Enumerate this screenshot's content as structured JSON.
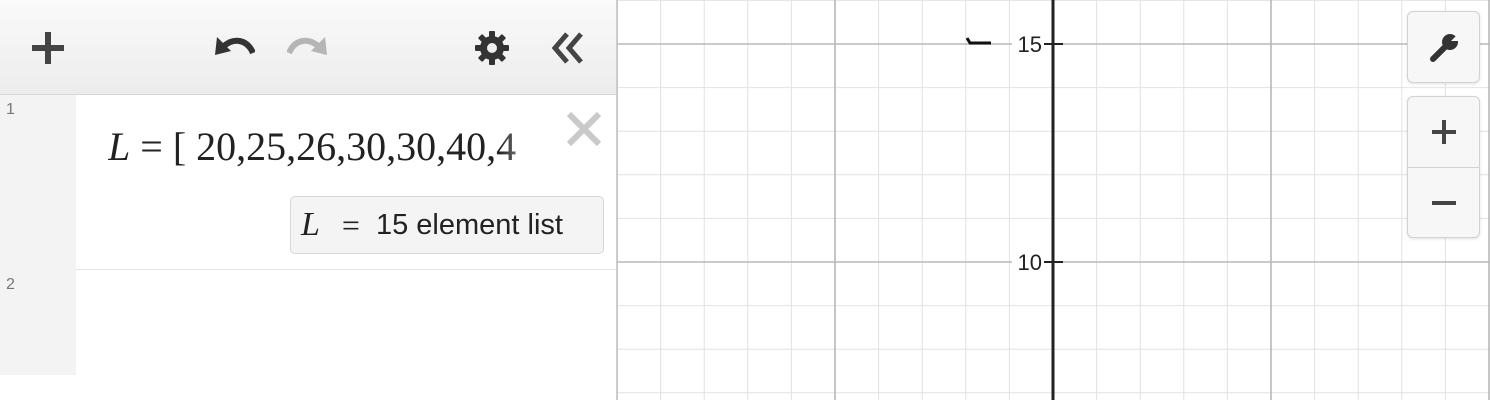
{
  "toolbar": {
    "add_icon": "plus-icon",
    "undo_icon": "undo-icon",
    "redo_icon": "redo-icon",
    "settings_icon": "gear-icon",
    "collapse_icon": "double-chevron-left-icon"
  },
  "expressions": [
    {
      "row_number": "1",
      "variable": "L",
      "equals": "=",
      "bracket": "[",
      "values_text": "20,25,26,30,30,40,4",
      "result_variable": "L",
      "result_equals": "=",
      "result_text": "15 element list"
    },
    {
      "row_number": "2"
    }
  ],
  "graph": {
    "y_tick_labels": [
      "15",
      "10"
    ],
    "colors": {
      "major_grid": "#b8b8b8",
      "minor_grid": "#e2e2e2",
      "axis": "#222222"
    }
  },
  "graph_controls": {
    "settings_icon": "wrench-icon",
    "zoom_in_icon": "plus-icon",
    "zoom_out_icon": "minus-icon"
  }
}
